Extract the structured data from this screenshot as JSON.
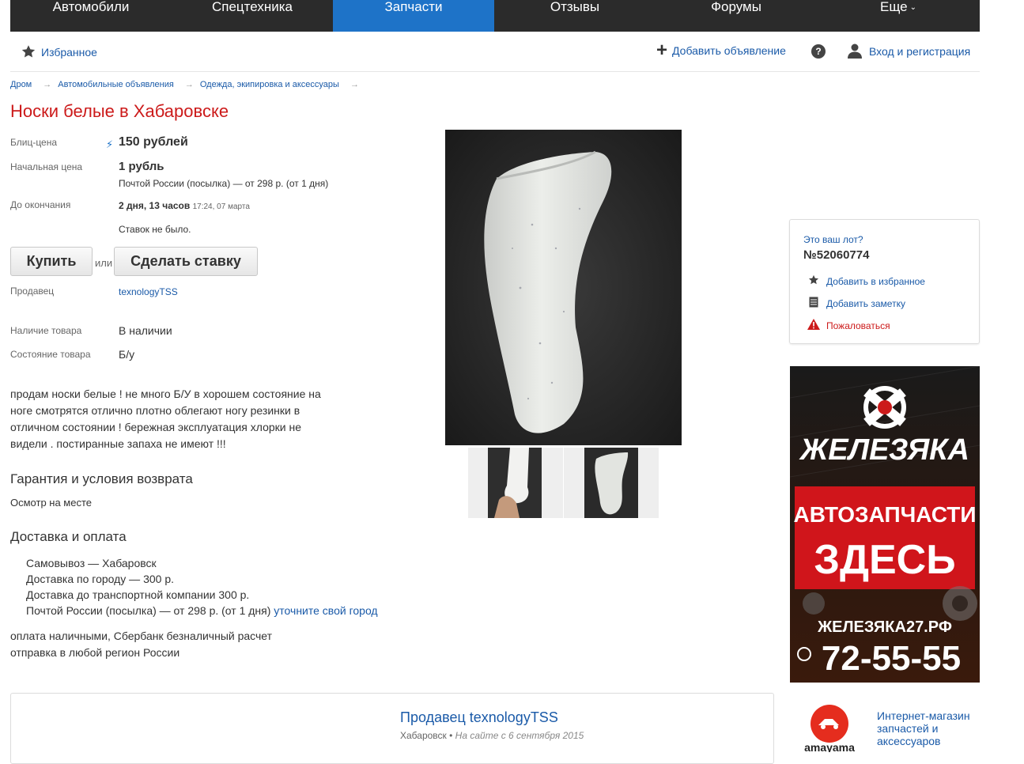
{
  "nav": {
    "items": [
      {
        "label": "Автомобили"
      },
      {
        "label": "Спецтехника"
      },
      {
        "label": "Запчасти",
        "active": true
      },
      {
        "label": "Отзывы"
      },
      {
        "label": "Форумы"
      },
      {
        "label": "Еще"
      }
    ],
    "active_color": "#1e73c8",
    "bg_color": "#2b2b2b"
  },
  "subheader": {
    "favorites": "Избранное",
    "add_ad": "Добавить объявление",
    "help": "?",
    "login": "Вход и регистрация"
  },
  "breadcrumb": [
    "Дром",
    "Автомобильные объявления",
    "Одежда, экипировка и аксессуары"
  ],
  "title": "Носки белые в Хабаровске",
  "lot": {
    "blitz_label": "Блиц-цена",
    "blitz_value": "150 рублей",
    "start_label": "Начальная цена",
    "start_value": "1 рубль",
    "shipping_note": "Почтой России (посылка) — от 298 р. (от 1 дня)",
    "ends_label": "До окончания",
    "ends_value": "2 дня, 13 часов",
    "ends_date": "17:24, 07 марта",
    "no_bids": "Ставок не было.",
    "buy_button": "Купить",
    "or": "или",
    "bid_button": "Сделать ставку",
    "seller_label": "Продавец",
    "seller_name": "texnologyTSS",
    "availability_label": "Наличие товара",
    "availability_value": "В наличии",
    "condition_label": "Состояние товара",
    "condition_value": "Б/у"
  },
  "description": "продам носки белые ! не много Б/У в хорошем состояние на ноге смотрятся отлично плотно облегают ногу резинки в отличном состоянии ! бережная эксплуатация хлорки не видели . постиранные запаха не имеют !!!",
  "warranty": {
    "heading": "Гарантия и условия возврата",
    "text": "Осмотр на месте"
  },
  "delivery": {
    "heading": "Доставка и оплата",
    "items": [
      "Самовывоз — Хабаровск",
      "Доставка по городу — 300 р.",
      "Доставка до транспортной компании 300 р.",
      "Почтой России (посылка) — от 298 р. (от 1 дня)"
    ],
    "city_link": "уточните свой город",
    "payment": "оплата наличными, Сбербанк безналичный расчет",
    "shipping": "отправка в любой регион России"
  },
  "lot_box": {
    "question": "Это ваш лот?",
    "number": "№52060774",
    "add_favorite": "Добавить в избранное",
    "add_note": "Добавить заметку",
    "complain": "Пожаловаться"
  },
  "banner": {
    "brand": "ЖЕЛЕЗЯКА",
    "line1": "АВТОЗАПЧАСТИ",
    "line2": "ЗДЕСЬ",
    "site": "ЖЕЛЕЗЯКА27.РФ",
    "phone": "72-55-55"
  },
  "seller_card": {
    "title": "Продавец texnologyTSS",
    "city": "Хабаровск",
    "since": "На сайте с 6 сентября 2015"
  },
  "amayama": {
    "logo_text": "amayama",
    "text": "Интернет-магазин запчастей и аксессуаров"
  }
}
